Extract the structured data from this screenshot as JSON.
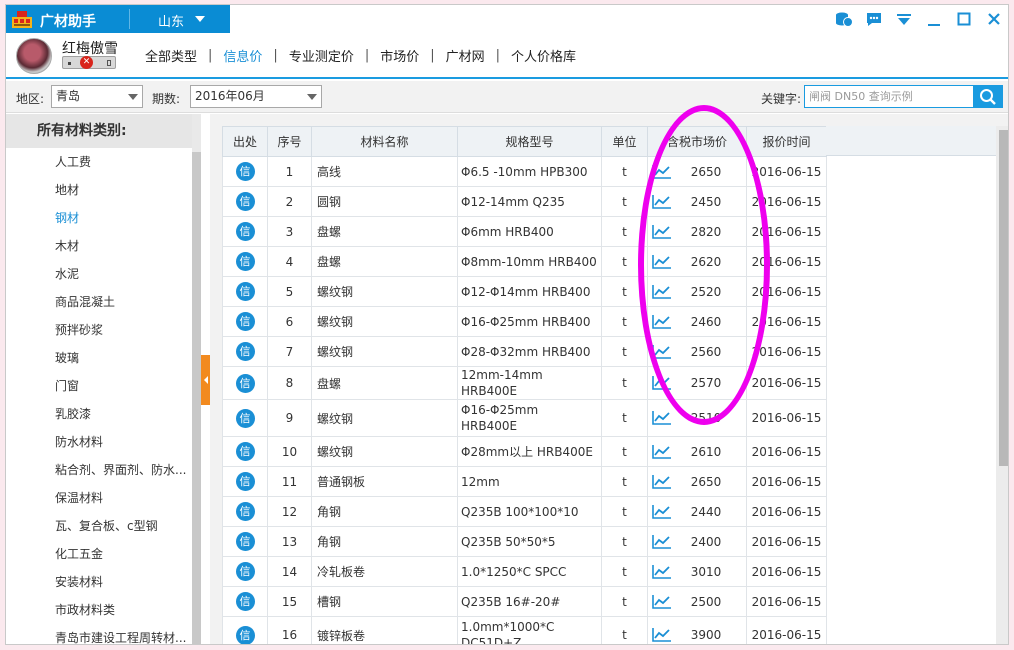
{
  "app": {
    "title": "广材助手",
    "province": "山东",
    "username": "红梅傲雪"
  },
  "nav": {
    "tabs": [
      "全部类型",
      "信息价",
      "专业测定价",
      "市场价",
      "广材网",
      "个人价格库"
    ],
    "active": "信息价"
  },
  "filters": {
    "region_label": "地区:",
    "region_value": "青岛",
    "period_label": "期数:",
    "period_value": "2016年06月",
    "keyword_label": "关键字:",
    "keyword_placeholder": "闸阀 DN50 查询示例"
  },
  "sidebar": {
    "header": "所有材料类别:",
    "items": [
      "人工费",
      "地材",
      "钢材",
      "木材",
      "水泥",
      "商品混凝土",
      "预拌砂浆",
      "玻璃",
      "门窗",
      "乳胶漆",
      "防水材料",
      "粘合剂、界面剂、防水...",
      "保温材料",
      "瓦、复合板、c型钢",
      "化工五金",
      "安装材料",
      "市政材料类",
      "青岛市建设工程周转材..."
    ],
    "active_index": 2
  },
  "table": {
    "columns": [
      "出处",
      "序号",
      "材料名称",
      "规格型号",
      "单位",
      "含税市场价",
      "报价时间"
    ],
    "info_badge": "信",
    "rows": [
      {
        "no": "1",
        "name": "高线",
        "spec": "Φ6.5 -10mm  HPB300",
        "unit": "t",
        "price": "2650",
        "date": "2016-06-15"
      },
      {
        "no": "2",
        "name": "圆钢",
        "spec": "Φ12-14mm  Q235",
        "unit": "t",
        "price": "2450",
        "date": "2016-06-15"
      },
      {
        "no": "3",
        "name": "盘螺",
        "spec": "Φ6mm   HRB400",
        "unit": "t",
        "price": "2820",
        "date": "2016-06-15"
      },
      {
        "no": "4",
        "name": "盘螺",
        "spec": "Φ8mm-10mm HRB400",
        "unit": "t",
        "price": "2620",
        "date": "2016-06-15"
      },
      {
        "no": "5",
        "name": "螺纹钢",
        "spec": "Φ12-Φ14mm    HRB400",
        "unit": "t",
        "price": "2520",
        "date": "2016-06-15"
      },
      {
        "no": "6",
        "name": "螺纹钢",
        "spec": "Φ16-Φ25mm    HRB400",
        "unit": "t",
        "price": "2460",
        "date": "2016-06-15"
      },
      {
        "no": "7",
        "name": "螺纹钢",
        "spec": "Φ28-Φ32mm     HRB400",
        "unit": "t",
        "price": "2560",
        "date": "2016-06-15"
      },
      {
        "no": "8",
        "name": "盘螺",
        "spec": "12mm-14mm  HRB400E",
        "unit": "t",
        "price": "2570",
        "date": "2016-06-15"
      },
      {
        "no": "9",
        "name": "螺纹钢",
        "spec": "Φ16-Φ25mm HRB400E",
        "unit": "t",
        "price": "2510",
        "date": "2016-06-15"
      },
      {
        "no": "10",
        "name": "螺纹钢",
        "spec": "Φ28mm以上 HRB400E",
        "unit": "t",
        "price": "2610",
        "date": "2016-06-15"
      },
      {
        "no": "11",
        "name": "普通钢板",
        "spec": "12mm",
        "unit": "t",
        "price": "2650",
        "date": "2016-06-15"
      },
      {
        "no": "12",
        "name": "角钢",
        "spec": "Q235B 100*100*10",
        "unit": "t",
        "price": "2440",
        "date": "2016-06-15"
      },
      {
        "no": "13",
        "name": "角钢",
        "spec": "Q235B  50*50*5",
        "unit": "t",
        "price": "2400",
        "date": "2016-06-15"
      },
      {
        "no": "14",
        "name": "冷轧板卷",
        "spec": "1.0*1250*C SPCC",
        "unit": "t",
        "price": "3010",
        "date": "2016-06-15"
      },
      {
        "no": "15",
        "name": "槽钢",
        "spec": "Q235B 16#-20#",
        "unit": "t",
        "price": "2500",
        "date": "2016-06-15"
      },
      {
        "no": "16",
        "name": "镀锌板卷",
        "spec": "1.0mm*1000*C  DC51D+Z",
        "unit": "t",
        "price": "3900",
        "date": "2016-06-15"
      }
    ]
  },
  "colors": {
    "brand": "#0a8cd4",
    "accent": "#1a8fd5",
    "highlight": "#ee00ee"
  }
}
